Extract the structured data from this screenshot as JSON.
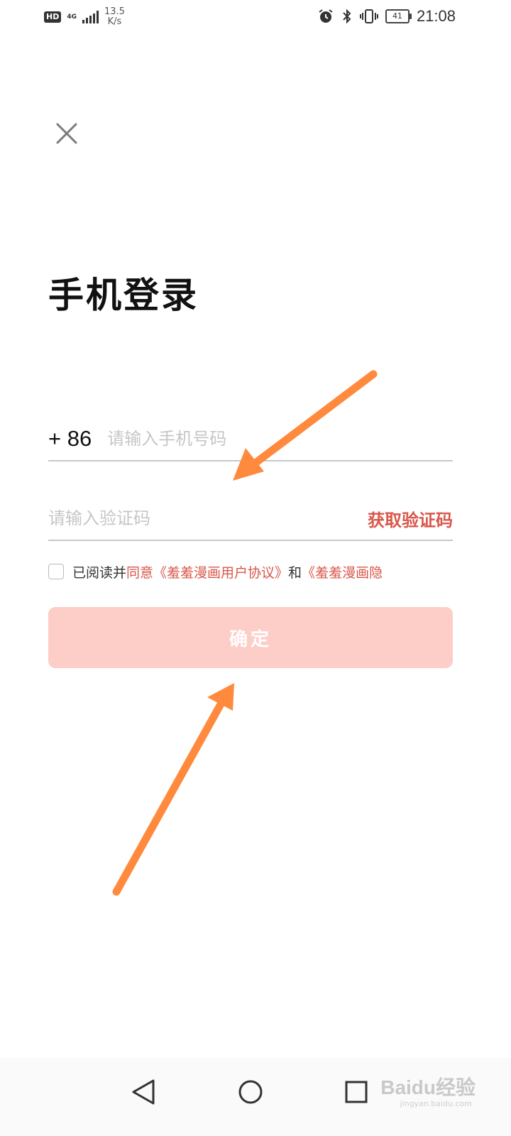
{
  "status_bar": {
    "hd": "HD",
    "network": "4G",
    "speed_value": "13.5",
    "speed_unit": "K/s",
    "battery": "41",
    "time": "21:08"
  },
  "page": {
    "title": "手机登录"
  },
  "phone": {
    "country_code": "+ 86",
    "placeholder": "请输入手机号码"
  },
  "verify": {
    "placeholder": "请输入验证码",
    "get_code_label": "获取验证码"
  },
  "agreement": {
    "prefix": "已阅读并",
    "agree": "同意",
    "user_agreement": "《羞羞漫画用户协议》",
    "and": "和",
    "privacy": "《羞羞漫画隐"
  },
  "confirm": {
    "label": "确定"
  },
  "watermark": {
    "brand": "Baidu经验",
    "url": "jingyan.baidu.com"
  },
  "colors": {
    "accent": "#d9574a",
    "button_bg": "#fdcdc8",
    "annotation_arrow": "#ff8a3d"
  }
}
